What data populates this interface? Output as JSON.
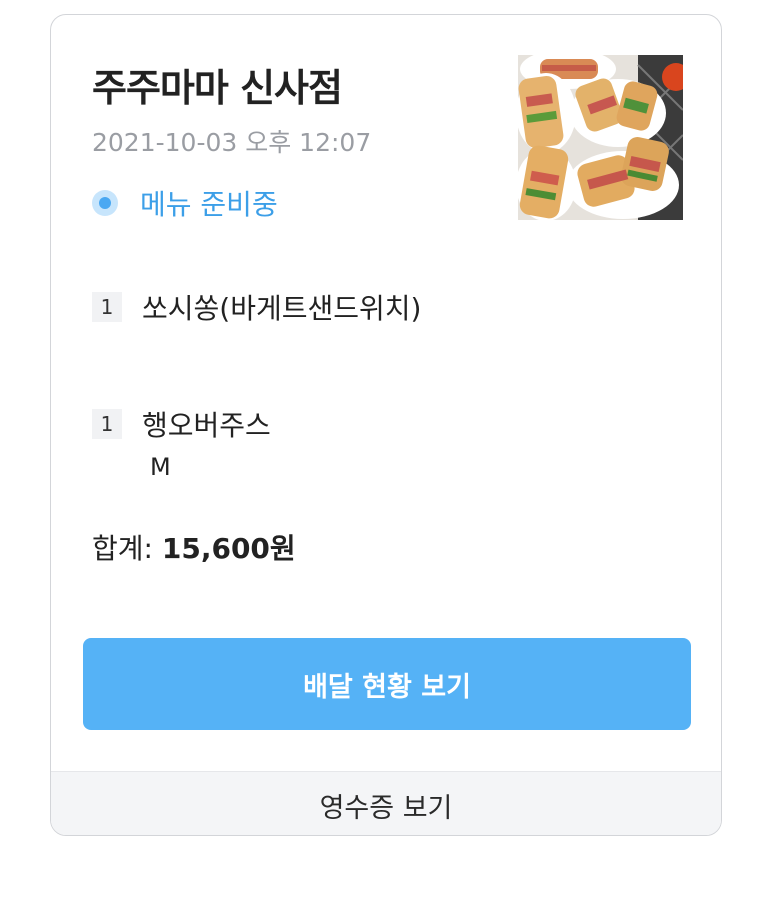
{
  "order": {
    "store_name": "주주마마 신사점",
    "datetime": "2021-10-03 오후 12:07",
    "status": "메뉴 준비중",
    "status_color": "#4aa8f2",
    "thumbnail_icon": "sandwich-photo"
  },
  "items": [
    {
      "qty": "1",
      "name": "쏘시쏭(바게트샌드위치)",
      "option": ""
    },
    {
      "qty": "1",
      "name": "행오버주스",
      "option": "M"
    }
  ],
  "total": {
    "label": "합계: ",
    "value": "15,600원"
  },
  "buttons": {
    "delivery_status": "배달 현황 보기",
    "receipt": "영수증 보기"
  },
  "colors": {
    "primary_button": "#55b2f6",
    "receipt_bar": "#f4f5f7"
  }
}
